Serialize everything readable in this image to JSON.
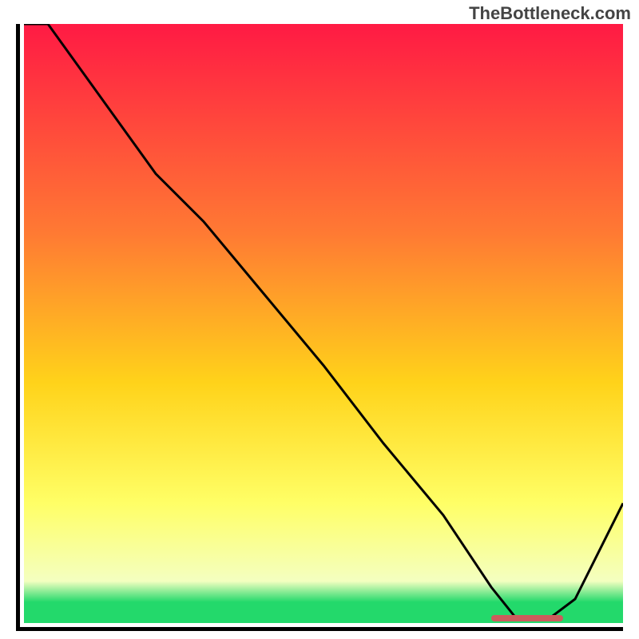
{
  "watermark": "TheBottleneck.com",
  "colors": {
    "top": "#ff1a44",
    "mid1": "#ff7a33",
    "mid2": "#ffd31a",
    "mid3": "#ffff66",
    "mid4": "#f4ffc0",
    "bottom_green": "#23d96b",
    "marker": "#cc5c5c",
    "line": "#000000"
  },
  "chart_data": {
    "type": "line",
    "title": "",
    "xlabel": "",
    "ylabel": "",
    "xlim": [
      0,
      100
    ],
    "ylim": [
      0,
      100
    ],
    "x": [
      0,
      4,
      22,
      30,
      40,
      50,
      60,
      70,
      78,
      82,
      88,
      92,
      100
    ],
    "values": [
      100,
      100,
      75,
      67,
      55,
      43,
      30,
      18,
      6,
      1,
      1,
      4,
      20
    ],
    "marker_region": {
      "x_start": 78,
      "x_end": 90,
      "y": 0.8
    },
    "gradient_stops": [
      {
        "offset": 0.0,
        "color_key": "top"
      },
      {
        "offset": 0.35,
        "color_key": "mid1"
      },
      {
        "offset": 0.6,
        "color_key": "mid2"
      },
      {
        "offset": 0.8,
        "color_key": "mid3"
      },
      {
        "offset": 0.93,
        "color_key": "mid4"
      },
      {
        "offset": 0.965,
        "color_key": "bottom_green"
      },
      {
        "offset": 1.0,
        "color_key": "bottom_green"
      }
    ]
  }
}
